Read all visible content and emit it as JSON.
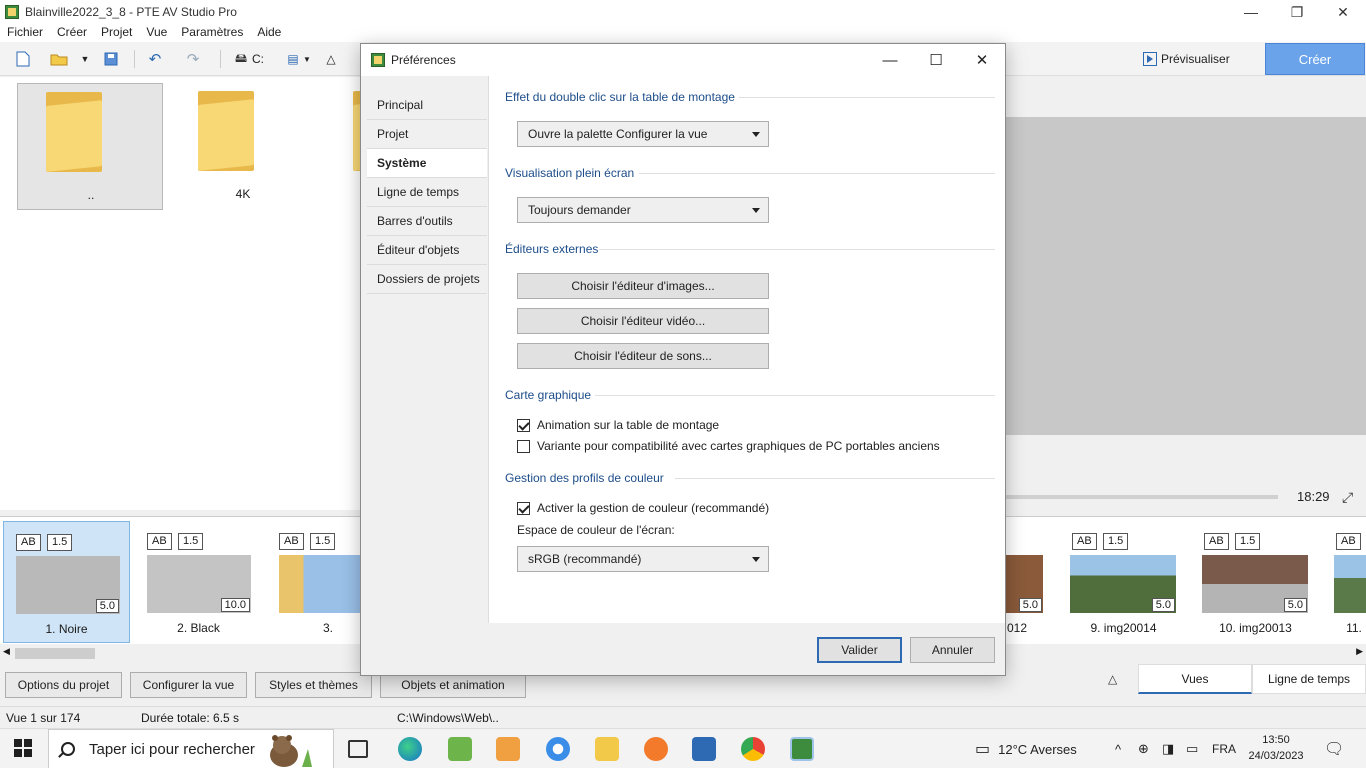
{
  "window": {
    "title": "Blainville2022_3_8 - PTE AV Studio Pro",
    "minimize": "—",
    "maximize": "❐",
    "close": "✕"
  },
  "menu": [
    "Fichier",
    "Créer",
    "Projet",
    "Vue",
    "Paramètres",
    "Aide"
  ],
  "toolbar": {
    "drive": "C:",
    "preview_label": "Prévisualiser",
    "create_label": "Créer"
  },
  "browser": {
    "folders": [
      {
        "label": ".."
      },
      {
        "label": "4K"
      }
    ]
  },
  "preview": {
    "time": "18:29"
  },
  "slides": [
    {
      "ab": "AB",
      "trans": "1.5",
      "dur": "5.0",
      "name": "1. Noire"
    },
    {
      "ab": "AB",
      "trans": "1.5",
      "dur": "10.0",
      "name": "2. Black"
    },
    {
      "ab": "AB",
      "trans": "1.5",
      "dur": "",
      "name": "3."
    },
    {
      "ab": "",
      "trans": "",
      "dur": "5.0",
      "name": "012"
    },
    {
      "ab": "AB",
      "trans": "1.5",
      "dur": "5.0",
      "name": "9. img20014"
    },
    {
      "ab": "AB",
      "trans": "1.5",
      "dur": "5.0",
      "name": "10. img20013"
    },
    {
      "ab": "AB",
      "trans": "",
      "dur": "",
      "name": "11."
    }
  ],
  "bottom": {
    "options": "Options du projet",
    "configure": "Configurer la vue",
    "styles": "Styles et thèmes",
    "objects": "Objets et animation",
    "tab_views": "Vues",
    "tab_timeline": "Ligne de temps"
  },
  "status": {
    "view": "Vue 1 sur 174",
    "duration": "Durée totale: 6.5 s",
    "path": "C:\\Windows\\Web\\.."
  },
  "taskbar": {
    "search_placeholder": "Taper ici pour rechercher",
    "weather": "12°C  Averses",
    "lang": "FRA",
    "time": "13:50",
    "date": "24/03/2023"
  },
  "dialog": {
    "title": "Préférences",
    "nav": [
      "Principal",
      "Projet",
      "Système",
      "Ligne de temps",
      "Barres d'outils",
      "Éditeur d'objets",
      "Dossiers de projets"
    ],
    "active_nav": "Système",
    "sections": {
      "double_click": {
        "title": "Effet du double clic sur la table de montage",
        "value": "Ouvre la palette Configurer la vue"
      },
      "fullscreen": {
        "title": "Visualisation plein écran",
        "value": "Toujours demander"
      },
      "editors": {
        "title": "Éditeurs externes",
        "image_btn": "Choisir l'éditeur d'images...",
        "video_btn": "Choisir l'éditeur vidéo...",
        "sound_btn": "Choisir l'éditeur de sons..."
      },
      "graphics": {
        "title": "Carte graphique",
        "anim_label": "Animation sur la table de montage",
        "anim_checked": true,
        "compat_label": "Variante pour compatibilité avec cartes graphiques de PC portables anciens",
        "compat_checked": false
      },
      "color": {
        "title": "Gestion des profils de couleur",
        "enable_label": "Activer la gestion de couleur (recommandé)",
        "enable_checked": true,
        "space_label": "Espace de couleur de l'écran:",
        "space_value": "sRGB (recommandé)"
      }
    },
    "ok": "Valider",
    "cancel": "Annuler"
  }
}
